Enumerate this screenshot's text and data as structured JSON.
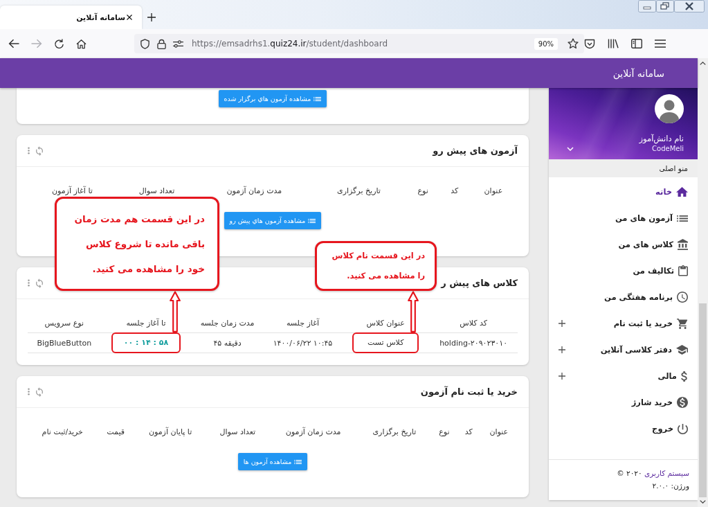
{
  "browser": {
    "tab": {
      "title": "سامانه آنلاین",
      "selected": true
    },
    "forward_disabled": true,
    "url": "https://emsadrhs1.**quiz24.ir**/student/dashboard",
    "zoom": "90%"
  },
  "header": {
    "title": "سامانه آنلاین"
  },
  "cards": [
    {
      "kind": "partial",
      "button": "مشاهده آزمون هاي برگزار شده"
    },
    {
      "kind": "table",
      "title": "آزمون های پیش رو",
      "columns": [
        "عنوان",
        "کد",
        "نوع",
        "تاریخ برگزاری",
        "مدت زمان آزمون",
        "تعداد سوال",
        "تا آغاز آزمون"
      ],
      "button": "مشاهده آزمون هاي پیش رو"
    },
    {
      "kind": "table",
      "title": "کلاس های پیش ر",
      "columns": [
        "کد کلاس",
        "عنوان کلاس",
        "آغاز جلسه",
        "مدت زمان جلسه",
        "تا آغاز جلسه",
        "نوع سرویس"
      ],
      "rows": [
        {
          "cells": [
            {
              "kind": "text",
              "text": "holding-۲۰۹۰۲۳۰۱۰"
            },
            {
              "kind": "text",
              "text": "کلاس تست",
              "callout": "در این قسمت نام کلاس را مشاهده می کنید."
            },
            {
              "kind": "text",
              "text": "۱۴۰۰/۰۶/۲۲ ۱۰:۴۵"
            },
            {
              "kind": "text",
              "text": "۴۵ دقیقه"
            },
            {
              "kind": "countdown",
              "text": "۰۰ : ۱۴ : ۵۸",
              "callout": "در این قسمت هم مدت زمان باقی مانده تا شروع کلاس خود را مشاهده می کنید."
            },
            {
              "kind": "text",
              "text": "BigBlueButton"
            }
          ]
        }
      ]
    },
    {
      "kind": "table",
      "title": "خرید یا ثبت نام آزمون",
      "columns": [
        "عنوان",
        "کد",
        "نوع",
        "تاریخ برگزاری",
        "مدت زمان آزمون",
        "تعداد سوال",
        "تا پایان آزمون",
        "قیمت",
        "خرید/ثبت نام"
      ],
      "button": "مشاهده آزمون ها"
    }
  ],
  "sidebar": {
    "user": {
      "name": "نام دانش‌آموز",
      "code": "CodeMeli"
    },
    "menu_label": "منو اصلی",
    "items": [
      {
        "label": "خانه",
        "kind": "link",
        "selected": true
      },
      {
        "label": "آزمون های من",
        "kind": "link",
        "selected": false
      },
      {
        "label": "کلاس های من",
        "kind": "link",
        "selected": false
      },
      {
        "label": "تکالیف من",
        "kind": "link",
        "selected": false
      },
      {
        "label": "برنامه هفتگی من",
        "kind": "link",
        "selected": false
      },
      {
        "label": "خرید یا ثبت نام",
        "kind": "group",
        "selected": false
      },
      {
        "label": "دفتر کلاسی آنلاین",
        "kind": "group",
        "selected": false
      },
      {
        "label": "مالی",
        "kind": "group",
        "selected": false
      },
      {
        "label": "خرید شارژ",
        "kind": "link",
        "selected": false
      },
      {
        "label": "خروج",
        "kind": "link",
        "selected": false
      }
    ],
    "footer": {
      "link": "سیستم کاربری",
      "copyright": "۲۰۲۰ ©",
      "version": "ورژن: ۲.۰.۰"
    }
  }
}
